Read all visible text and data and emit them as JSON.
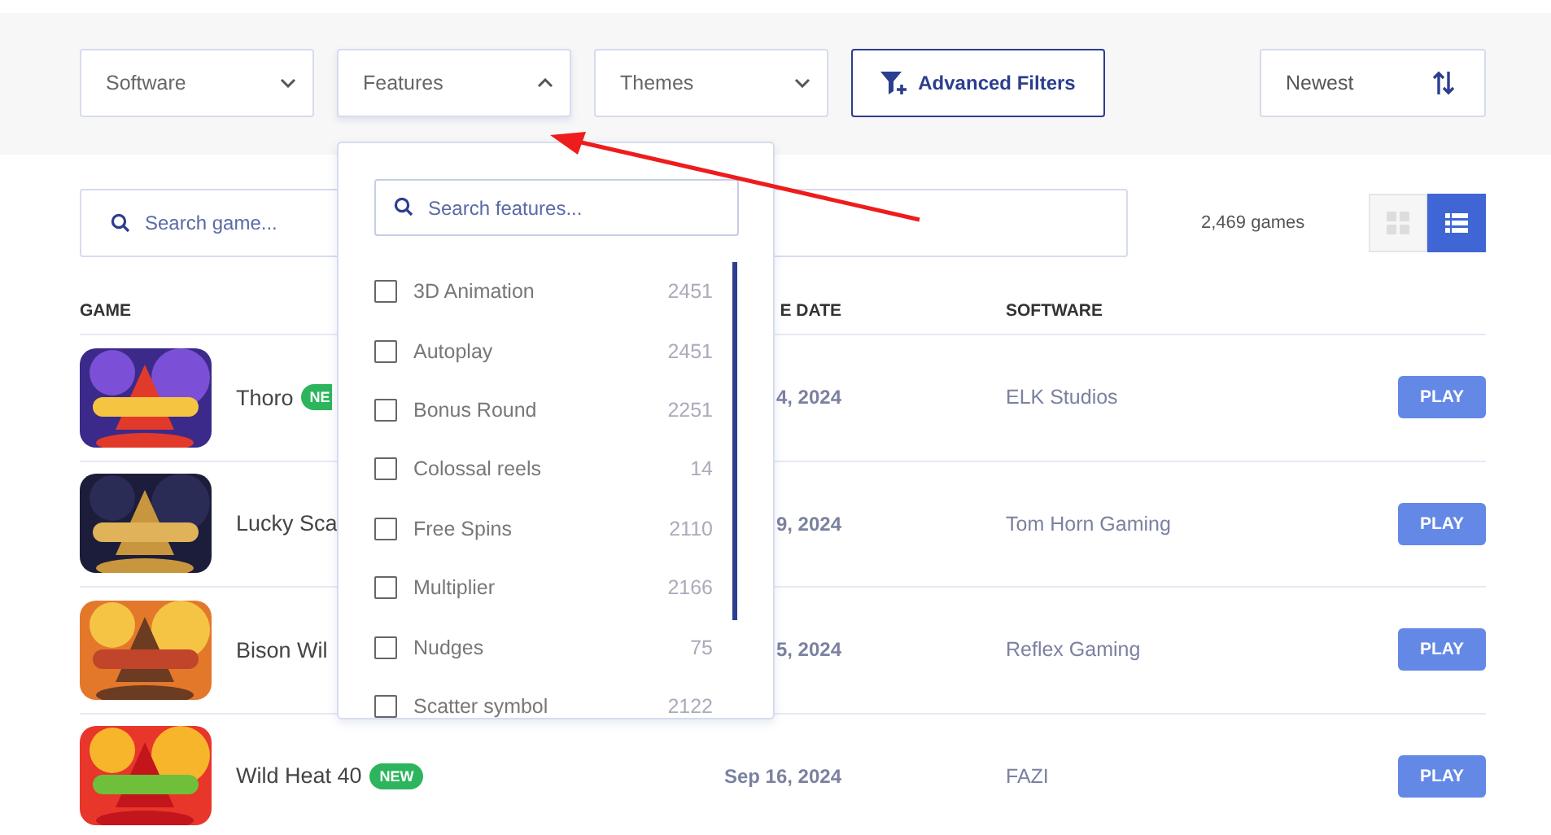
{
  "filters": [
    {
      "label": "Software",
      "expanded": false
    },
    {
      "label": "Features",
      "expanded": true
    },
    {
      "label": "Themes",
      "expanded": false
    }
  ],
  "advanced_filters": {
    "label": "Advanced Filters"
  },
  "sort": {
    "label": "Newest"
  },
  "search": {
    "placeholder": "Search game..."
  },
  "game_count": "2,469 games",
  "view_toggle": [
    {
      "kind": "grid",
      "selected": false
    },
    {
      "kind": "list",
      "selected": true
    }
  ],
  "features_dropdown": {
    "search_placeholder": "Search features...",
    "items": [
      {
        "label": "3D Animation",
        "count": "2451",
        "checked": false
      },
      {
        "label": "Autoplay",
        "count": "2451",
        "checked": false
      },
      {
        "label": "Bonus Round",
        "count": "2251",
        "checked": false
      },
      {
        "label": "Colossal reels",
        "count": "14",
        "checked": false
      },
      {
        "label": "Free Spins",
        "count": "2110",
        "checked": false
      },
      {
        "label": "Multiplier",
        "count": "2166",
        "checked": false
      },
      {
        "label": "Nudges",
        "count": "75",
        "checked": false
      },
      {
        "label": "Scatter symbol",
        "count": "2122",
        "checked": false
      }
    ]
  },
  "table": {
    "columns": [
      "GAME",
      "E DATE",
      "SOFTWARE"
    ],
    "rows": [
      {
        "name": "Thoro",
        "badge": "NE",
        "date": "4, 2024",
        "software": "ELK Studios",
        "action": "PLAY"
      },
      {
        "name": "Lucky Sca",
        "date": "9, 2024",
        "software": "Tom Horn Gaming",
        "action": "PLAY"
      },
      {
        "name": "Bison Wil",
        "date": "5, 2024",
        "software": "Reflex Gaming",
        "action": "PLAY"
      },
      {
        "name": "Wild Heat 40",
        "badge": "NEW",
        "date": "Sep 16, 2024",
        "software": "FAZI",
        "action": "PLAY"
      }
    ]
  }
}
